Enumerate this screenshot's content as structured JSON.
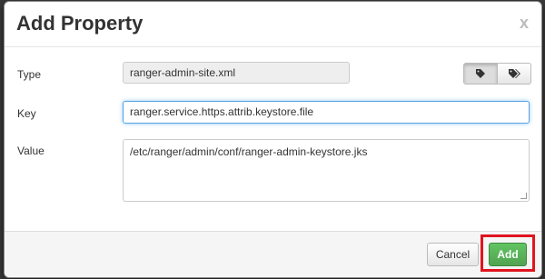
{
  "dialog": {
    "title": "Add Property",
    "close_label": "x"
  },
  "form": {
    "type_label": "Type",
    "type_value": "ranger-admin-site.xml",
    "key_label": "Key",
    "key_value": "ranger.service.https.attrib.keystore.file",
    "value_label": "Value",
    "value_value": "/etc/ranger/admin/conf/ranger-admin-keystore.jks"
  },
  "tag_toggle": {
    "left_icon": "tag-icon",
    "right_icon": "tags-icon",
    "active": "left"
  },
  "footer": {
    "cancel_label": "Cancel",
    "add_label": "Add"
  },
  "colors": {
    "add_button": "#51a351",
    "highlight": "#e0141e",
    "focus_border": "#5aa3e0"
  }
}
